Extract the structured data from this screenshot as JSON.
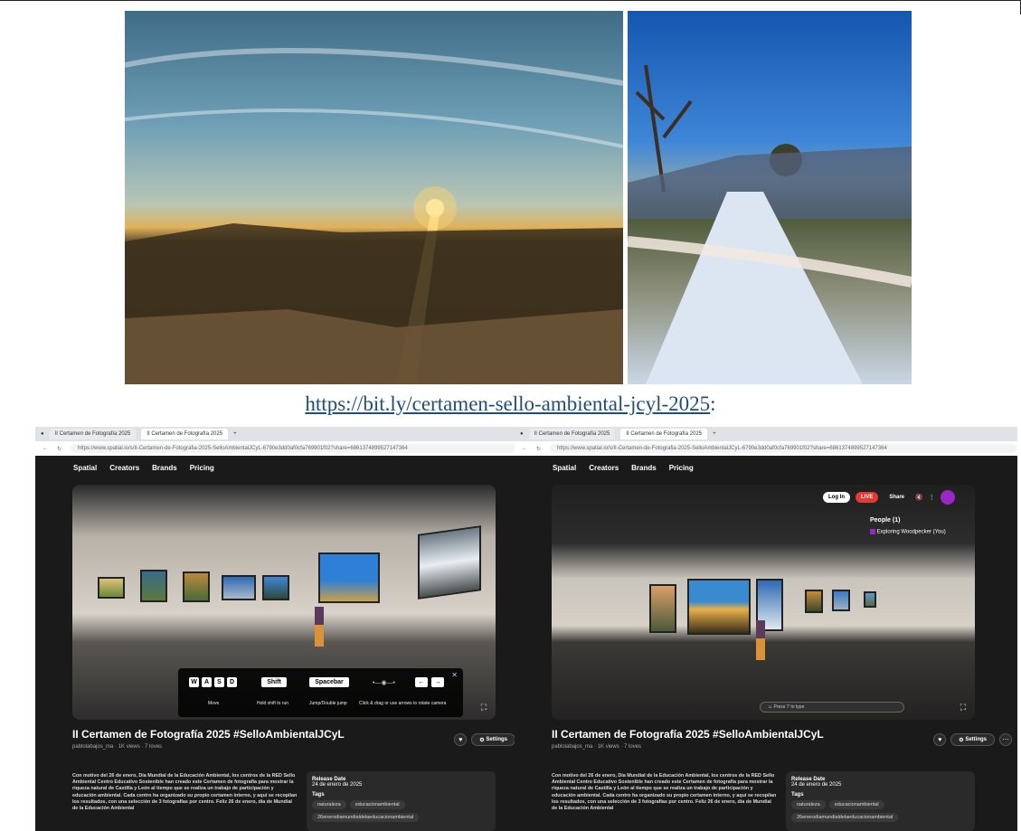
{
  "link": {
    "text": "https://bit.ly/certamen-sello-ambiental-jcyl-2025",
    "suffix": ":"
  },
  "browser": {
    "tab1": "II Certamen de Fotografía 2025",
    "tab2": "II Certamen de Fotografía 2025",
    "url1": "https://www.spatial.io/s/II-Certamen-de-Fotografia-2025-SelloAmbientalJCyL-6790e3dd0af0cfa769901f02?share=6861374899527147364",
    "url2": "https://www.spatial.io/s/II-Certamen-de-Fotografia-2025-SelloAmbientalJCyL-6790e3dd0af0cfa769901f02?share=6861374899527147364"
  },
  "nav": {
    "logo": "Spatial",
    "creators": "Creators",
    "brands": "Brands",
    "pricing": "Pricing"
  },
  "controls": {
    "keys": [
      "W",
      "A",
      "S",
      "D"
    ],
    "shift": "Shift",
    "spacebar": "Spacebar",
    "left": "←",
    "right": "→",
    "move": "Move",
    "run": "Hold shift to run",
    "jump": "Jump/Double jump",
    "rotate": "Click & drag or use arrows to rotate camera"
  },
  "space": {
    "title": "II Certamen de Fotografía 2025 #SelloAmbientalJCyL",
    "meta": "pablolabajos_ma · 1K views · 7 loves",
    "settings": "Settings",
    "description": "Con motivo del 26 de enero, Día Mundial de la Educación Ambiental, los centros de la RED Sello Ambiental Centro Educativo Sostenible han creado este Certamen de fotografía para mostrar la riqueza natural de Castilla y León al tiempo que se realiza un trabajo de participación y educación ambiental. Cada centro ha organizado su propio certamen interno, y aquí se recopilan los resultados, con una selección de 3 fotografías por centro. Feliz 26 de enero, día de Mundial de la Educación Ambiental",
    "release_label": "Release Date",
    "release_value": "24 de enero de 2025",
    "tags_label": "Tags",
    "tags": [
      "naturaleza",
      "educacionambiental"
    ],
    "extra_tag": "26enerodiamundialdelaeducacionambiental"
  },
  "overlay": {
    "login": "Log In",
    "live": "LIVE",
    "share": "Share",
    "people_title": "People (1)",
    "person": "Exploring Woodpecker (You)",
    "chat_placeholder": "Press '/' to type"
  }
}
